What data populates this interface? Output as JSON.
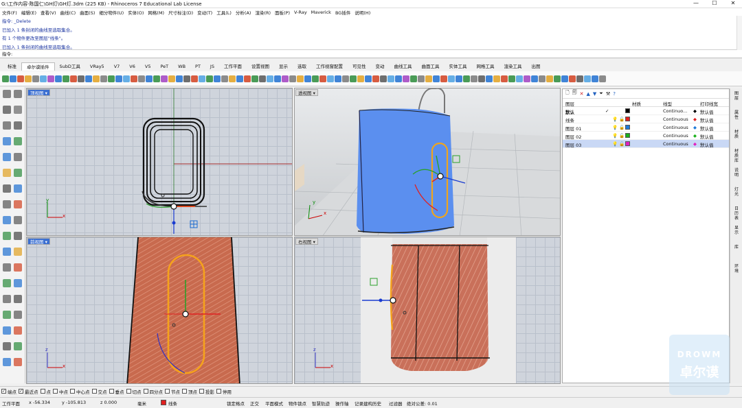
{
  "window": {
    "title": "G:\\工作内容-陈国仁\\GH灯\\GH灯.3dm (225 KB) - Rhinoceros 7 Educational Lab License",
    "minimize": "—",
    "maximize": "☐",
    "close": "✕"
  },
  "menu": [
    "文件(F)",
    "编辑(E)",
    "查看(V)",
    "曲线(C)",
    "曲面(S)",
    "细分物件(U)",
    "实体(O)",
    "网格(M)",
    "尺寸标注(D)",
    "变动(T)",
    "工具(L)",
    "分析(A)",
    "渲染(R)",
    "面板(P)",
    "V-Ray",
    "Maverick",
    "BG插件",
    "说明(H)"
  ],
  "command_history": [
    "指令: _Delete",
    "已加入 1 条封闭的曲线至选取集合。",
    "有 1 个物件更改至图层\"线条\"。",
    "已加入 1 条封闭的曲线至选取集合。"
  ],
  "command_prompt": "指令:",
  "tabs": [
    "标准",
    "卓尔谟插件",
    "SubD工具",
    "VRay5",
    "V7",
    "V6",
    "V5",
    "PeT",
    "WB",
    "PT",
    "JS",
    "工作平面",
    "设置视图",
    "显示",
    "选取",
    "工作视窗配置",
    "可见性",
    "变动",
    "曲线工具",
    "曲面工具",
    "实体工具",
    "网格工具",
    "渲染工具",
    "出图"
  ],
  "active_tab": "卓尔谟插件",
  "viewports": {
    "top": "顶视图",
    "perspective": "透视图",
    "front": "前视图",
    "right": "右视图"
  },
  "axis": {
    "x": "x",
    "y": "y",
    "z": "z"
  },
  "layers_panel": {
    "headers": {
      "name": "图层",
      "material": "材质",
      "linetype": "线型",
      "print_color": "打印线宽"
    },
    "rows": [
      {
        "name": "默认",
        "check": "✓",
        "color": "#000000",
        "linetype": "Continuo...",
        "print": "默认值",
        "bold": true
      },
      {
        "name": "线条",
        "check": "",
        "color": "#e02020",
        "linetype": "Continuous",
        "print": "默认值",
        "bold": false
      },
      {
        "name": "图层 01",
        "check": "",
        "color": "#1f7ad8",
        "linetype": "Continuous",
        "print": "默认值",
        "bold": false
      },
      {
        "name": "图层 02",
        "check": "",
        "color": "#19b019",
        "linetype": "Continuous",
        "print": "默认值",
        "bold": false
      },
      {
        "name": "图层 03",
        "check": "",
        "color": "#e020c0",
        "linetype": "Continuous",
        "print": "默认值",
        "bold": false
      }
    ]
  },
  "side_tabs": [
    "图层",
    "属性",
    "材质",
    "材质库",
    "说明",
    "灯光",
    "日历表",
    "显示",
    "库",
    "环境"
  ],
  "osnap": [
    {
      "label": "端点",
      "checked": true
    },
    {
      "label": "最近点",
      "checked": true
    },
    {
      "label": "点",
      "checked": false
    },
    {
      "label": "中点",
      "checked": false
    },
    {
      "label": "中心点",
      "checked": false
    },
    {
      "label": "交点",
      "checked": false
    },
    {
      "label": "垂点",
      "checked": false
    },
    {
      "label": "切点",
      "checked": false
    },
    {
      "label": "四分点",
      "checked": false
    },
    {
      "label": "节点",
      "checked": false
    },
    {
      "label": "顶点",
      "checked": false
    },
    {
      "label": "投影",
      "checked": false
    },
    {
      "label": "停用",
      "checked": false
    }
  ],
  "status": {
    "cplane": "工作平面",
    "x": "x -56.334",
    "y": "y -105.813",
    "z": "z 0.000",
    "units": "毫米",
    "layer": "线条",
    "items": [
      "锁定格点",
      "正交",
      "平面模式",
      "物件锁点",
      "智慧轨迹",
      "操作轴",
      "记录建构历史",
      "过滤器",
      "绝对公差: 0.01"
    ]
  },
  "watermark": {
    "top": "DROWM",
    "bottom": "卓尔谟"
  }
}
